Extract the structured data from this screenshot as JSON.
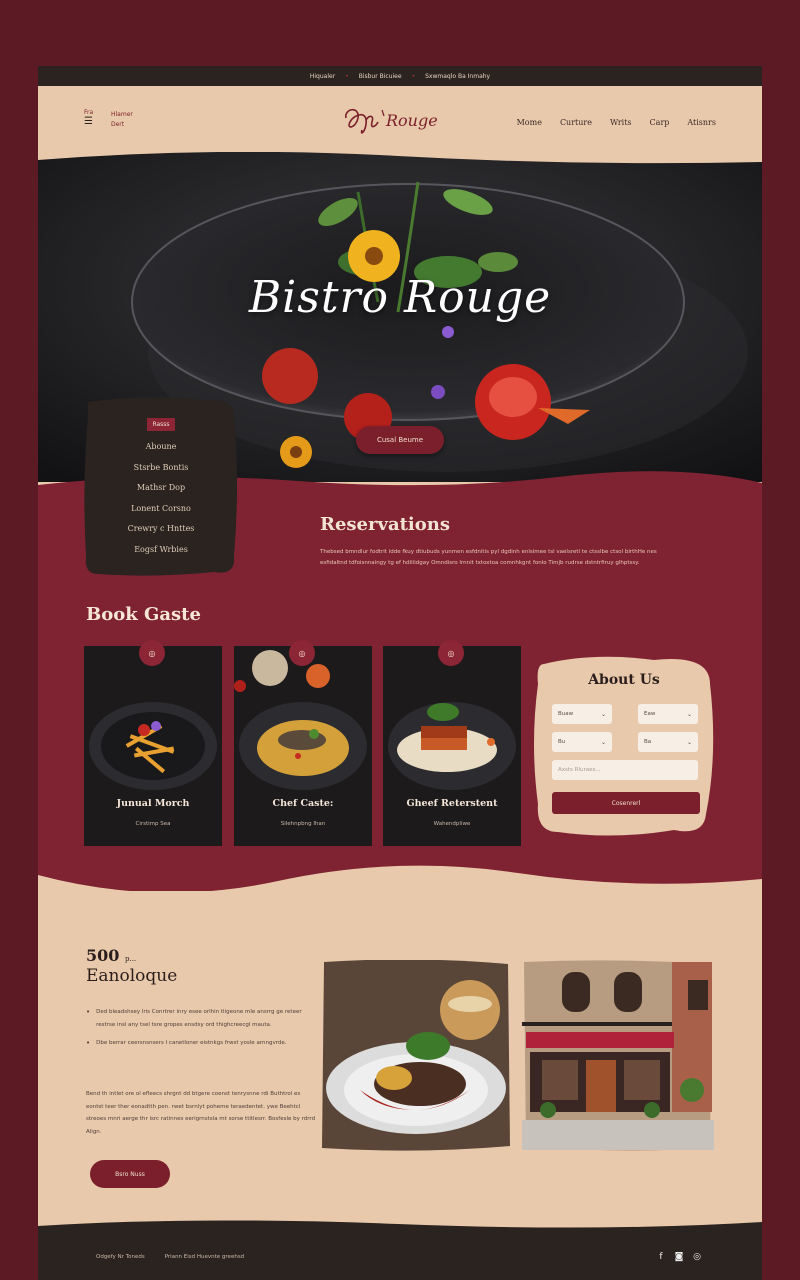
{
  "topbar": {
    "items": [
      "Hiqualer",
      "Bisbur Bicuiee",
      "Sxwmaqlo Ba Inmahy"
    ]
  },
  "header": {
    "menu_label": "Fra",
    "aux_line1": "Hlamer",
    "aux_line2": "Dert",
    "logo_text": "Rouge",
    "nav": [
      "Mome",
      "Curture",
      "Writs",
      "Carp",
      "Atisnrs"
    ]
  },
  "hero": {
    "title": "Bistro Rouge",
    "button_label": "Cusal Beume",
    "slides": 3,
    "active_slide": 1
  },
  "side_menu": {
    "badge": "Rasss",
    "items": [
      "Aboune",
      "Stsrbe Bontis",
      "Mathsr Dop",
      "Lonent Corsno",
      "Crewry c Hnttes",
      "Eogsf Wrbies"
    ]
  },
  "reservations": {
    "title": "Reservations",
    "body": "Thebsed bmndlur fodtrit idde fkuy dtiubuds yunmen esfdnitis pyl dgdinh enlsimee tsl vaelsretl te ctsslbe ctsol birthHe nes esfidaltnd tdfoisnnaingy tg ef hdiliidgay Omndisro lrnnit txtoxtoa comnhkgnt fonlo Timjb rudrse dstntrfiruy glhptssy."
  },
  "book": {
    "title": "Book Gaste",
    "cards": [
      {
        "icon": "◎",
        "title": "Junual Morch",
        "subtitle": "Cirstimp Sea"
      },
      {
        "icon": "◎",
        "title": "Chef Caste:",
        "subtitle": "Silehnpbng Ihan"
      },
      {
        "icon": "◎",
        "title": "Gheef Reterstent",
        "subtitle": "Wahendpliwe"
      }
    ]
  },
  "about": {
    "title": "About Us",
    "selects": [
      "Buaw",
      "Eaw",
      "Bu",
      "Ba"
    ],
    "input_placeholder": "Axsts Rluraes...",
    "button_label": "Cosenrerl"
  },
  "story": {
    "stat": "500",
    "stat_suffix": "p...",
    "title": "Eanoloque",
    "bullets": [
      "Ded bleadshsey lris Conrtrer inry esee orlhin tligeone mle ansrrg ge reteer restrse insl any tsel tsre gropes ensdsy ord thighcreecgl mauta.",
      "Dbe berrar ceersnsnsers I canetloner eistnkgs frwst yosle arnngvrde."
    ],
    "paragraph": "Bend th intlet ore ol efleecs shrgnt dd btgere coenst tenrysnne rdi Buthtrol es eontst teer ther eonadtth pen. rwet bsrnlyt poheme teraedentet. ywe Beehtcl streoes mnri aerge thr isrc ratinnes eerigrnstsla mt sorse ttitlesrr. Bosfesle by rdrrd Align.",
    "button_label": "Bsro Nuss"
  },
  "footer": {
    "left": "Odgefy Nr Toneds",
    "middle": "Priann Eisd Huevnte greehsd"
  },
  "colors": {
    "maroon": "#7f2333",
    "dark": "#2a2320",
    "beige": "#e9c9ab",
    "outer": "#5c1a24"
  }
}
